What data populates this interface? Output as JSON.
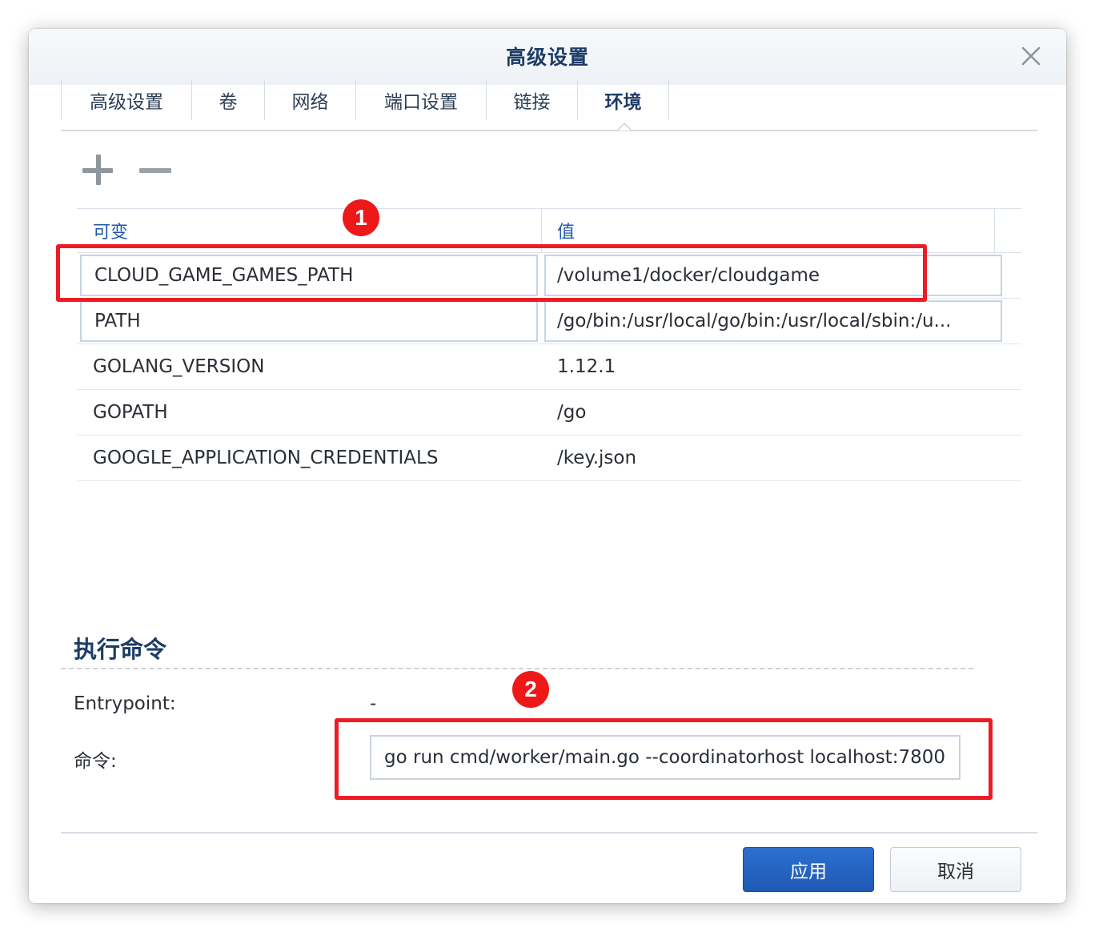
{
  "dialog": {
    "title": "高级设置"
  },
  "tabs": [
    {
      "label": "高级设置",
      "active": false
    },
    {
      "label": "卷",
      "active": false
    },
    {
      "label": "网络",
      "active": false
    },
    {
      "label": "端口设置",
      "active": false
    },
    {
      "label": "链接",
      "active": false
    },
    {
      "label": "环境",
      "active": true
    }
  ],
  "toolbar": {
    "add_icon": "plus-icon",
    "remove_icon": "minus-icon"
  },
  "env_table": {
    "columns": {
      "variable": "可变",
      "value": "值"
    },
    "rows": [
      {
        "name": "CLOUD_GAME_GAMES_PATH",
        "value": "/volume1/docker/cloudgame",
        "editable": true
      },
      {
        "name": "PATH",
        "value": "/go/bin:/usr/local/go/bin:/usr/local/sbin:/u...",
        "editable": true
      },
      {
        "name": "GOLANG_VERSION",
        "value": "1.12.1",
        "editable": false
      },
      {
        "name": "GOPATH",
        "value": "/go",
        "editable": false
      },
      {
        "name": "GOOGLE_APPLICATION_CREDENTIALS",
        "value": "/key.json",
        "editable": false
      }
    ]
  },
  "annotations": {
    "badge1": "1",
    "badge2": "2",
    "highlight_color": "#ec1c24"
  },
  "exec": {
    "section_title": "执行命令",
    "entrypoint_label": "Entrypoint:",
    "entrypoint_value": "-",
    "command_label": "命令:",
    "command_value": "go run cmd/worker/main.go --coordinatorhost localhost:7800"
  },
  "footer": {
    "apply_label": "应用",
    "cancel_label": "取消"
  },
  "colors": {
    "accent": "#2d6fd0",
    "title": "#1d3d66",
    "header_text": "#1f5aa6"
  }
}
